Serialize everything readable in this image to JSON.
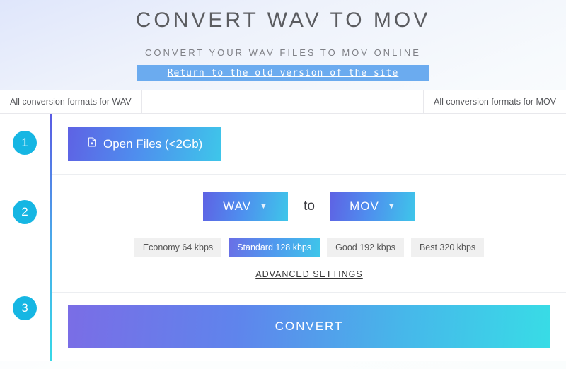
{
  "header": {
    "title": "CONVERT WAV TO MOV",
    "subtitle": "CONVERT YOUR WAV FILES TO MOV ONLINE",
    "old_version_link": "Return to the old version of the site"
  },
  "tabs": {
    "left": "All conversion formats for WAV",
    "right": "All conversion formats for MOV"
  },
  "steps": {
    "badges": [
      "1",
      "2",
      "3"
    ],
    "open_files_label": "Open Files (<2Gb)",
    "formats": {
      "from": "WAV",
      "to_label": "to",
      "to": "MOV"
    },
    "quality": {
      "options": [
        "Economy 64 kbps",
        "Standard 128 kbps",
        "Good 192 kbps",
        "Best 320 kbps"
      ],
      "selected_index": 1
    },
    "advanced_label": "ADVANCED SETTINGS",
    "convert_label": "CONVERT"
  }
}
